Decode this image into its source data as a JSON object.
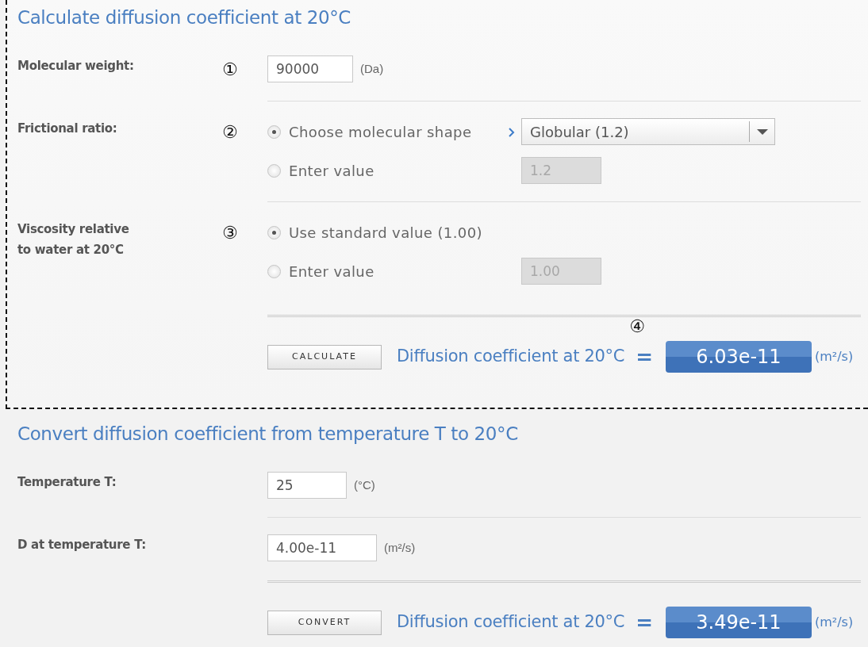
{
  "sections": [
    {
      "title": "Calculate diffusion coefficient at 20°C",
      "outlined": true,
      "rows": [
        {
          "kind": "input",
          "label": "Molecular weight:",
          "marker": "①",
          "value": "90000",
          "unit": "(Da)"
        },
        {
          "kind": "radio_group",
          "label": "Frictional ratio:",
          "marker": "②",
          "options": [
            {
              "label": "Choose molecular shape",
              "selected": true,
              "control": {
                "kind": "select",
                "value": "Globular (1.2)"
              }
            },
            {
              "label": "Enter value",
              "selected": false,
              "control": {
                "kind": "input",
                "value": "1.2",
                "disabled": true
              }
            }
          ]
        },
        {
          "kind": "radio_group",
          "label": "Viscosity relative\nto water at 20°C",
          "marker": "③",
          "options": [
            {
              "label": "Use standard value (1.00)",
              "selected": true
            },
            {
              "label": "Enter value",
              "selected": false,
              "control": {
                "kind": "input",
                "value": "1.00",
                "disabled": true
              }
            }
          ]
        }
      ],
      "result": {
        "button": "CALCULATE",
        "label": "Diffusion coefficient at 20°C",
        "marker": "④",
        "equals": "=",
        "value": "6.03e-11",
        "unit": "(m²/s)"
      }
    },
    {
      "title": "Convert diffusion coefficient from temperature T to 20°C",
      "outlined": false,
      "rows": [
        {
          "kind": "input",
          "label": "Temperature T:",
          "value": "25",
          "unit": "(°C)"
        },
        {
          "kind": "input",
          "label": "D at temperature T:",
          "value": "4.00e-11",
          "unit": "(m²/s)"
        }
      ],
      "result": {
        "button": "CONVERT",
        "label": "Diffusion coefficient at 20°C",
        "equals": "=",
        "value": "3.49e-11",
        "unit": "(m²/s)"
      }
    }
  ]
}
